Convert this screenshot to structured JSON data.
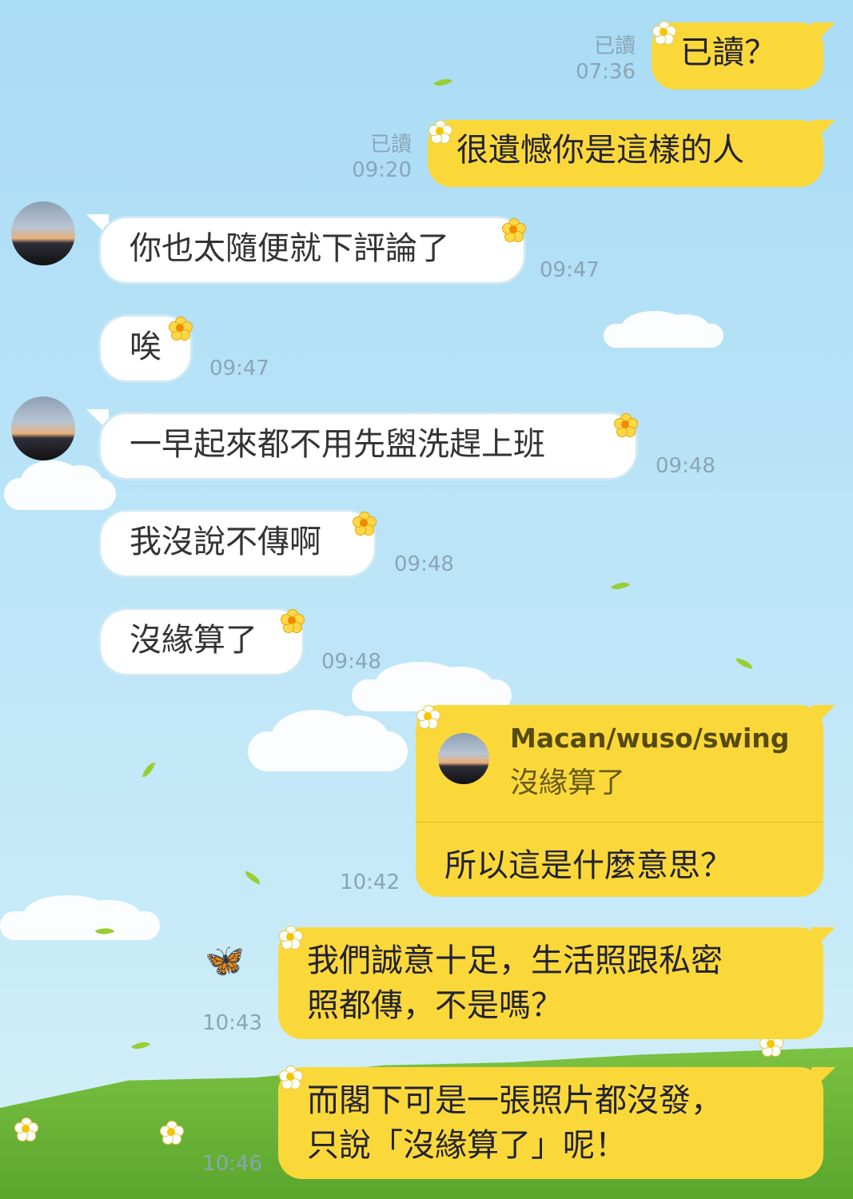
{
  "messages": [
    {
      "text": "已讀？",
      "read": "已讀",
      "time": "07:36"
    },
    {
      "text": "很遺憾你是這樣的人",
      "read": "已讀",
      "time": "09:20"
    },
    {
      "text": "你也太隨便就下評論了",
      "time": "09:47"
    },
    {
      "text": "唉",
      "time": "09:47"
    },
    {
      "text": "一早起來都不用先盥洗趕上班",
      "time": "09:48"
    },
    {
      "text": "我沒說不傳啊",
      "time": "09:48"
    },
    {
      "text": "沒緣算了",
      "time": "09:48"
    },
    {
      "quote_name": "Macan/wuso/swing",
      "quote_text": "沒緣算了",
      "text": "所以這是什麼意思？",
      "time": "10:42"
    },
    {
      "line1": "我們誠意十足，生活照跟私密",
      "line2": "照都傳，不是嗎？",
      "time": "10:43"
    },
    {
      "line1": "而閣下可是一張照片都沒發，",
      "line2": "只說「沒緣算了」呢！",
      "time": "10:46"
    }
  ],
  "colors": {
    "my_bubble": "#fbd83a",
    "their_bubble": "#ffffff",
    "meta_text": "#8aa5b5"
  }
}
